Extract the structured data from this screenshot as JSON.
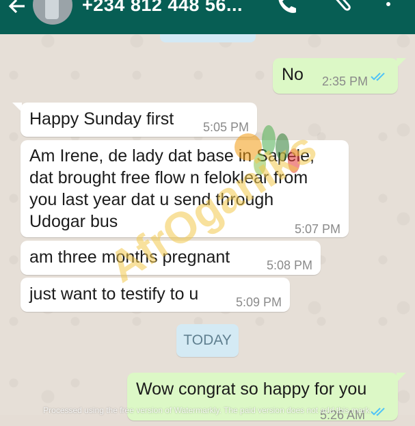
{
  "header": {
    "contact_name": "+234 812 448 56...",
    "back_icon": "arrow-left-icon",
    "call_icon": "phone-icon",
    "attach_icon": "paperclip-icon",
    "menu_icon": "more-vertical-icon"
  },
  "messages": [
    {
      "direction": "out",
      "text": "No",
      "time": "2:35 PM",
      "status": "read"
    },
    {
      "direction": "in",
      "text": "Happy Sunday first",
      "time": "5:05 PM"
    },
    {
      "direction": "in",
      "text": "Am Irene, de lady dat base in Sapele,\ndat brought free flow n feloklear from\nyou last year dat u send through\nUdogar bus",
      "time": "5:07 PM"
    },
    {
      "direction": "in",
      "text": "am three months pregnant",
      "time": "5:08 PM"
    },
    {
      "direction": "in",
      "text": "just want to testify to u",
      "time": "5:09 PM"
    },
    {
      "direction": "out",
      "text": "Wow congrat so happy for you",
      "time": "5:26 AM",
      "status": "read"
    }
  ],
  "date_divider": "TODAY",
  "watermark": {
    "logo_text": "AfrOganiks",
    "processing_note": "Processed using the free version of Watermarkly. The paid version does not add this mark."
  },
  "colors": {
    "header": "#075e54",
    "outgoing": "#dcf8c6",
    "incoming": "#ffffff",
    "read_tick": "#4fc3f7",
    "date_chip": "#d4eaf4"
  }
}
